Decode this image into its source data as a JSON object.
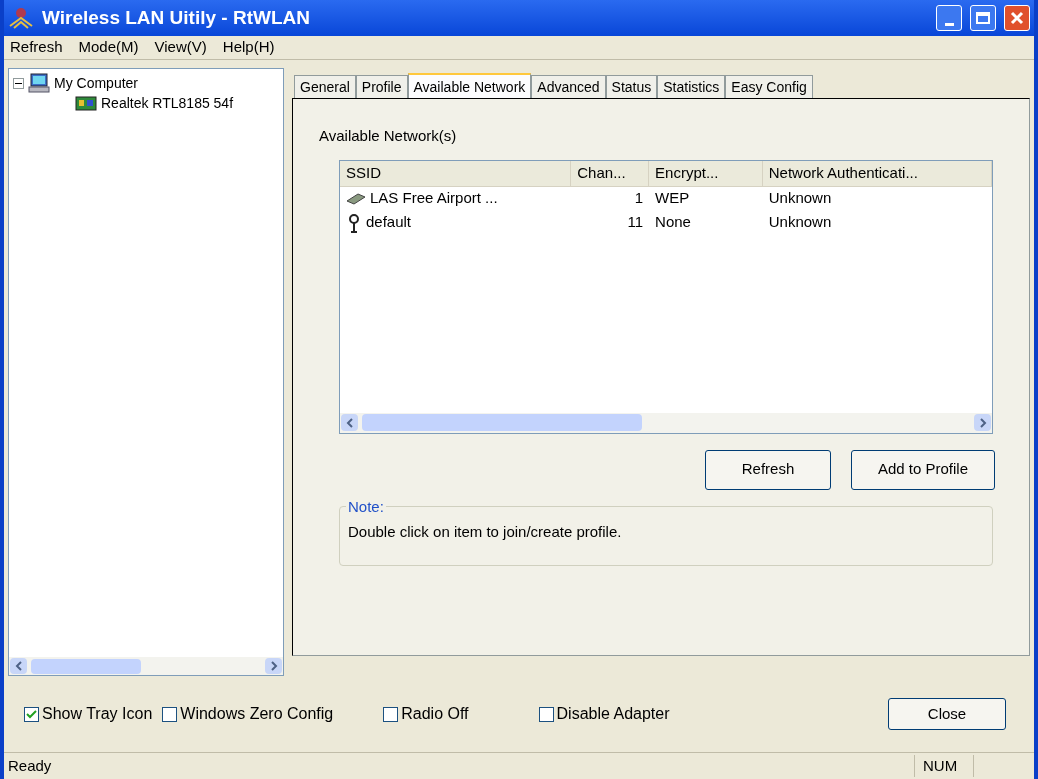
{
  "window": {
    "title": "Wireless LAN Uitily - RtWLAN"
  },
  "menu": [
    "Refresh",
    "Mode(M)",
    "View(V)",
    "Help(H)"
  ],
  "tree": [
    {
      "label": "My Computer",
      "expanded": true,
      "children": [
        {
          "label": "Realtek RTL8185 54f"
        }
      ]
    }
  ],
  "tabs": [
    {
      "label": "General",
      "selected": false
    },
    {
      "label": "Profile",
      "selected": false
    },
    {
      "label": "Available Network",
      "selected": true
    },
    {
      "label": "Advanced",
      "selected": false
    },
    {
      "label": "Status",
      "selected": false
    },
    {
      "label": "Statistics",
      "selected": false
    },
    {
      "label": "Easy Config",
      "selected": false
    }
  ],
  "section_label": "Available Network(s)",
  "table": {
    "columns": [
      "SSID",
      "Chan...",
      "Encrypt...",
      "Network Authenticati..."
    ],
    "rows": [
      {
        "kind": "adhoc",
        "cells": [
          "LAS Free Airport ...",
          "1",
          "WEP",
          "Unknown"
        ]
      },
      {
        "kind": "infrastructure",
        "cells": [
          "default",
          "11",
          "None",
          "Unknown"
        ]
      }
    ]
  },
  "buttons": [
    "Refresh",
    "Add to Profile"
  ],
  "note": {
    "title": "Note:",
    "text": "Double click on item to join/create profile."
  },
  "options": [
    {
      "label": "Show Tray Icon",
      "checked": true
    },
    {
      "label": "Windows Zero Config",
      "checked": false
    },
    {
      "label": "Radio Off",
      "checked": false
    },
    {
      "label": "Disable Adapter",
      "checked": false
    }
  ],
  "close_button": "Close",
  "status_bar": {
    "text": "Ready",
    "indicator": "NUM"
  }
}
